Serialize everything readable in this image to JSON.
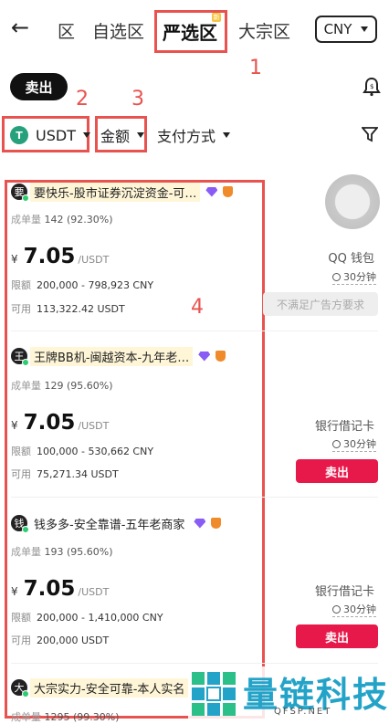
{
  "nav": {
    "back": "←",
    "tabs": [
      "区",
      "自选区",
      "严选区",
      "大宗区"
    ],
    "new_badge": "新",
    "currency": "CNY"
  },
  "sell_pill": "卖出",
  "filters": {
    "coin": "USDT",
    "amount": "金额",
    "payment": "支付方式"
  },
  "annotations": [
    "1",
    "2",
    "3",
    "4"
  ],
  "listings": [
    {
      "avatar": "要",
      "name": "要快乐-股市证券沉淀资金-可…",
      "stat_label": "成单量",
      "stat_value": "142 (92.30%)",
      "currency_symbol": "¥",
      "price": "7.05",
      "unit": "/USDT",
      "limit_label": "限额",
      "limit": "200,000 - 798,923 CNY",
      "avail_label": "可用",
      "available": "113,322.42 USDT",
      "payment": "QQ 钱包",
      "time": "30分钟",
      "action": "不满足广告方要求"
    },
    {
      "avatar": "王",
      "name": "王牌BB机-闽越资本-九年老…",
      "stat_label": "成单量",
      "stat_value": "129 (95.60%)",
      "currency_symbol": "¥",
      "price": "7.05",
      "unit": "/USDT",
      "limit_label": "限额",
      "limit": "100,000 - 530,662 CNY",
      "avail_label": "可用",
      "available": "75,271.34 USDT",
      "payment": "银行借记卡",
      "time": "30分钟",
      "action": "卖出"
    },
    {
      "avatar": "钱",
      "name": "钱多多-安全靠谱-五年老商家",
      "stat_label": "成单量",
      "stat_value": "193 (95.60%)",
      "currency_symbol": "¥",
      "price": "7.05",
      "unit": "/USDT",
      "limit_label": "限额",
      "limit": "200,000 - 1,410,000 CNY",
      "avail_label": "可用",
      "available": "200,000 USDT",
      "payment": "银行借记卡",
      "time": "30分钟",
      "action": "卖出"
    },
    {
      "avatar": "大",
      "name": "大宗实力-安全可靠-本人实名",
      "stat_label": "成单量",
      "stat_value": "1295 (99.30%)"
    }
  ],
  "watermark": {
    "text": "量链科技",
    "sub": "QFSP.NET"
  },
  "colors": {
    "annotation_red": "#e8534f",
    "sell_red": "#e7184a",
    "usdt_green": "#26a17b",
    "watermark_blue": "#24a3c8"
  }
}
